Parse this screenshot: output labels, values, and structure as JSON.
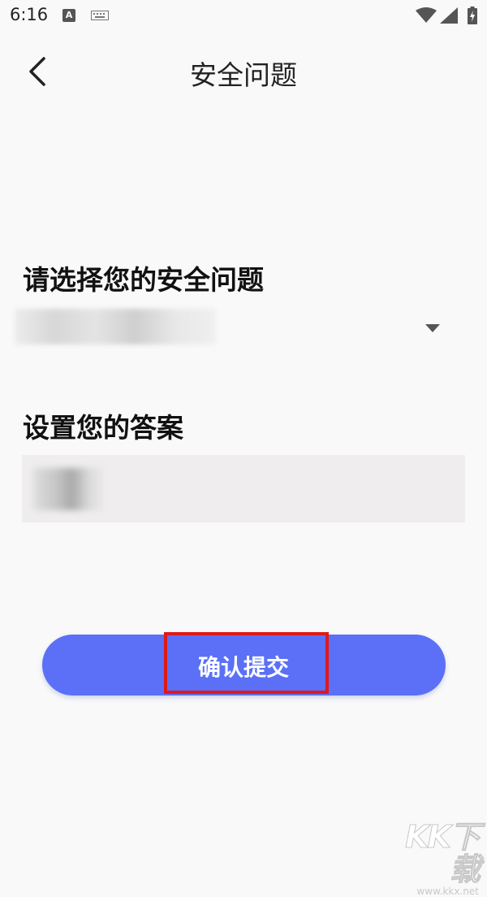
{
  "status_bar": {
    "time": "6:16",
    "keyboard_indicator": "A",
    "icons": [
      "keyboard-icon",
      "wifi-icon",
      "signal-icon",
      "battery-charging-icon"
    ]
  },
  "header": {
    "title": "安全问题",
    "back_icon": "chevron-left-icon"
  },
  "question": {
    "label": "请选择您的安全问题",
    "selected_value": ""
  },
  "answer": {
    "label": "设置您的答案",
    "value": ""
  },
  "submit": {
    "label": "确认提交"
  },
  "watermark": {
    "text": "KK下载",
    "url": "www.kkx.net"
  },
  "colors": {
    "background": "#f9f9f9",
    "button": "#5b70f7",
    "highlight": "#e01818",
    "input_bg": "#efeded"
  }
}
